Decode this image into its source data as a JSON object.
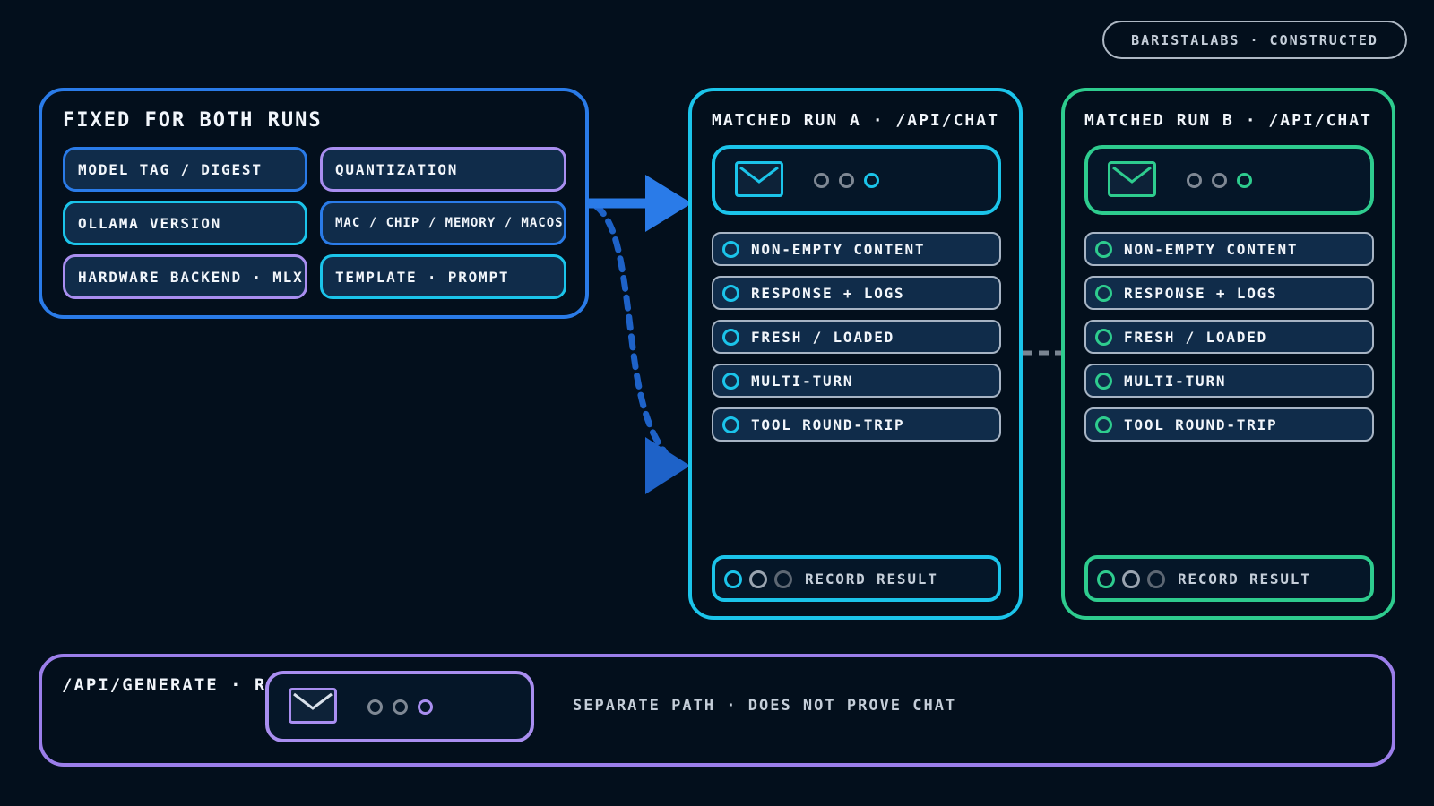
{
  "badge": {
    "label": "BARISTALABS · CONSTRUCTED"
  },
  "fixed": {
    "title": "FIXED FOR BOTH RUNS",
    "chips": [
      {
        "label": "MODEL TAG / DIGEST"
      },
      {
        "label": "QUANTIZATION"
      },
      {
        "label": "OLLAMA VERSION"
      },
      {
        "label": "MAC / CHIP / MEMORY / MACOS"
      },
      {
        "label": "HARDWARE BACKEND · MLX"
      },
      {
        "label": "TEMPLATE · PROMPT"
      }
    ]
  },
  "run_a": {
    "title": "MATCHED RUN A · /API/CHAT",
    "checks": [
      {
        "label": "NON-EMPTY CONTENT"
      },
      {
        "label": "RESPONSE + LOGS"
      },
      {
        "label": "FRESH / LOADED"
      },
      {
        "label": "MULTI-TURN"
      },
      {
        "label": "TOOL ROUND-TRIP"
      }
    ],
    "record_label": "RECORD RESULT"
  },
  "run_b": {
    "title": "MATCHED RUN B · /API/CHAT",
    "checks": [
      {
        "label": "NON-EMPTY CONTENT"
      },
      {
        "label": "RESPONSE + LOGS"
      },
      {
        "label": "FRESH / LOADED"
      },
      {
        "label": "MULTI-TURN"
      },
      {
        "label": "TOOL ROUND-TRIP"
      }
    ],
    "record_label": "RECORD RESULT"
  },
  "generate": {
    "title": "/API/GENERATE · RA",
    "note": "SEPARATE PATH · DOES NOT PROVE CHAT"
  },
  "colors": {
    "background": "#030f1c",
    "blue": "#2a7be8",
    "cyan": "#1bc4ea",
    "green": "#2ecc8e",
    "purple": "#9b7eea",
    "chip_fill": "#102c4a"
  },
  "icons": [
    "envelope-icon",
    "status-dot-icon",
    "check-ring-icon",
    "arrow-icon"
  ]
}
